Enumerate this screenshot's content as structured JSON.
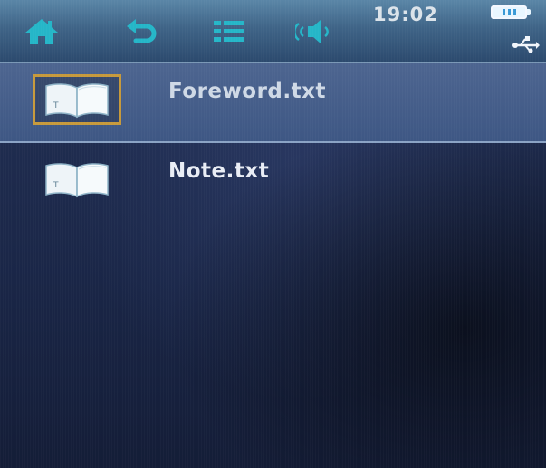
{
  "status_bar": {
    "time": "19:02",
    "icons": [
      "home-icon",
      "back-icon",
      "list-icon",
      "volume-icon",
      "battery-icon",
      "usb-icon"
    ]
  },
  "files": [
    {
      "name": "Foreword.txt",
      "icon": "book-icon",
      "selected": true
    },
    {
      "name": "Note.txt",
      "icon": "book-icon",
      "selected": false
    }
  ],
  "colors": {
    "toolbar": "#3f6487",
    "background": "#1f2c4f",
    "selection": "#4d6590",
    "selection_border": "#c79a3c",
    "icon_teal": "#25b6c8"
  }
}
